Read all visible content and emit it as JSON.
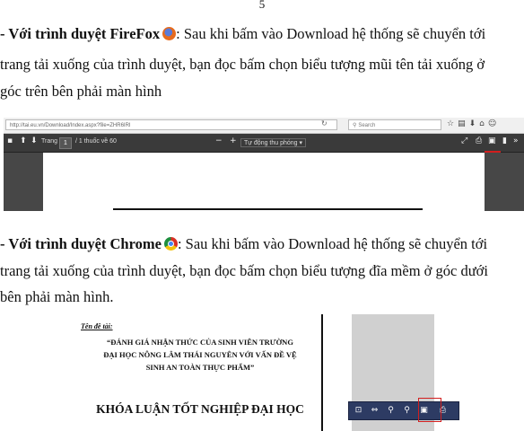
{
  "page_number": "5",
  "firefox_section": {
    "heading": "- Với trình duyệt FireFox",
    "icon": "firefox-icon",
    "text_line1": ": Sau khi bấm vào Download hệ thống sẽ chuyển tới",
    "text_line2": "trang tải xuống của trình duyệt, bạn đọc bấm chọn biểu tượng mũi tên tải xuống ở",
    "text_line3": "góc trên bên phải màn hình",
    "screenshot": {
      "url": "http://tai.eu.vn/Download/Index.aspx?file=ZHR6IRI",
      "search_placeholder": "Search",
      "page_label": "Trang",
      "page_value": "1",
      "page_of": "/ 1 thuốc về 60",
      "zoom_label": "Tự động thu phóng",
      "accent": "#d21e1e"
    }
  },
  "chrome_section": {
    "heading": "- Với trình duyệt Chrome",
    "icon": "chrome-icon",
    "text_line1": ": Sau khi bấm vào Download hệ thống sẽ chuyển tới",
    "text_line2": "trang tải xuống của trình duyệt, bạn đọc bấm chọn biểu tượng đĩa mềm ở góc dưới",
    "text_line3": "bên phải màn hình.",
    "screenshot": {
      "doc_label": "Tên đề tài:",
      "doc_title1": "“ĐÁNH GIÁ NHẬN THỨC CỦA SINH VIÊN TRƯỜNG",
      "doc_title2": "ĐẠI HỌC NÔNG LÂM THÁI NGUYÊN VỚI VẤN ĐỀ VỆ",
      "doc_title3": "SINH AN TOÀN THỰC PHẨM”",
      "doc_heading": "KHÓA LUẬN TỐT NGHIỆP ĐẠI HỌC",
      "toolbar_color": "#2d3b63"
    }
  }
}
